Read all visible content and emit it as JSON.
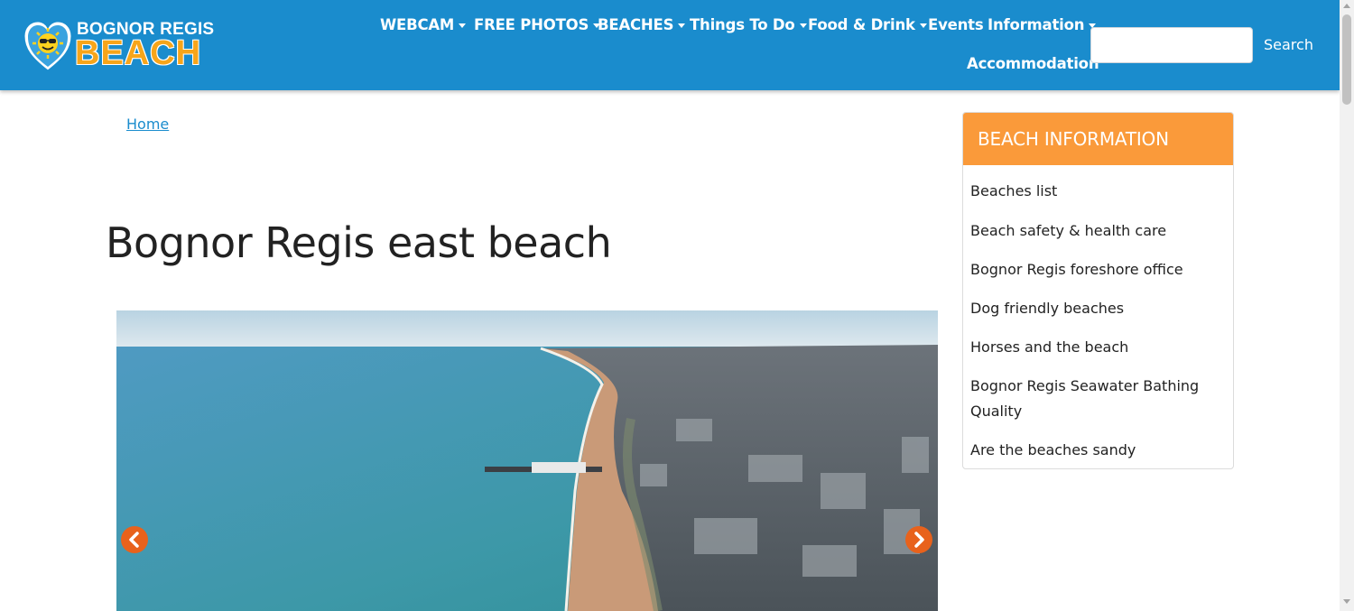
{
  "header": {
    "logo_top": "BOGNOR REGIS",
    "logo_bottom": "BEACH",
    "nav": [
      {
        "label": "WEBCAM",
        "dropdown": true
      },
      {
        "label": "FREE PHOTOS",
        "dropdown": true
      },
      {
        "label": "BEACHES",
        "dropdown": true
      },
      {
        "label": "Things To Do",
        "dropdown": true
      },
      {
        "label": "Food & Drink",
        "dropdown": true
      },
      {
        "label": "Events",
        "dropdown": false
      },
      {
        "label": "Information",
        "dropdown": true
      },
      {
        "label": "Accommodation",
        "dropdown": false
      }
    ],
    "search": {
      "placeholder": "",
      "button_label": "Search"
    }
  },
  "breadcrumb": {
    "home": "Home"
  },
  "page_title": "Bognor Regis east beach",
  "sidebar": {
    "heading": "BEACH INFORMATION",
    "links": [
      "Beaches list",
      "Beach safety & health care",
      "Bognor Regis foreshore office",
      "Dog friendly beaches",
      "Horses and the beach",
      "Bognor Regis Seawater Bathing Quality",
      "Are the beaches sandy"
    ]
  },
  "colors": {
    "header_bg": "#1a8ccd",
    "sidebar_head_bg": "#fa9a3a",
    "carousel_arrow": "#e8621c",
    "logo_beach": "#f7a51a"
  }
}
